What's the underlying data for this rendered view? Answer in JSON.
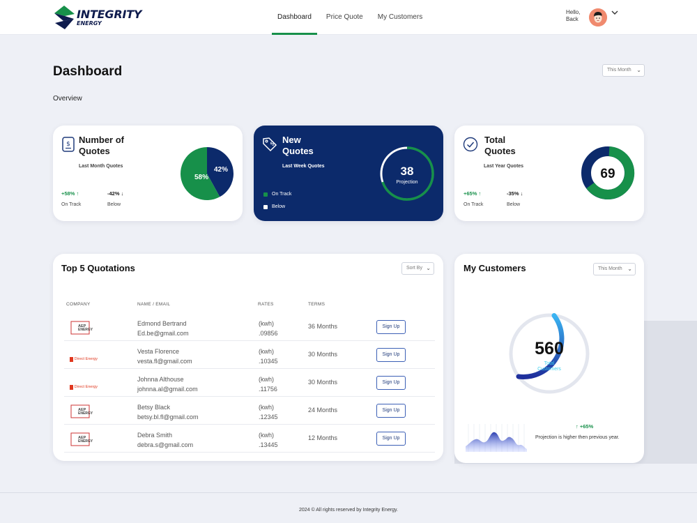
{
  "brand": {
    "name_line1": "INTEGRITY",
    "name_line2": "ENERGY",
    "colors": {
      "green": "#17904a",
      "navy": "#0c2a6b"
    }
  },
  "nav": {
    "items": [
      {
        "label": "Dashboard",
        "active": true
      },
      {
        "label": "Price Quote"
      },
      {
        "label": "My Customers"
      }
    ]
  },
  "user": {
    "greeting_line1": "Hello,",
    "greeting_line2": "Back",
    "avatar_icon": "avatar-icon",
    "menu_icon": "chevron-down-icon"
  },
  "page": {
    "title": "Dashboard",
    "subtitle": "Overview",
    "period_select": "This Month"
  },
  "cards": {
    "quotes": {
      "title_line1": "Number of",
      "title_line2": "Quotes",
      "subtitle": "Last Month Quotes",
      "icon": "invoice-dollar-icon",
      "stat1_value": "+58%",
      "stat1_arrow": "↑",
      "stat1_label": "On Track",
      "stat2_value": "-42%",
      "stat2_arrow": "↓",
      "stat2_label": "Below",
      "pie": {
        "green_label": "58%",
        "navy_label": "42%",
        "green_value": 58,
        "navy_value": 42
      }
    },
    "new_quotes": {
      "title_line1": "New",
      "title_line2": "Quotes",
      "subtitle": "Last Week Quotes",
      "icon": "price-tag-icon",
      "legend1": "On Track",
      "legend2": "Below",
      "value": "38",
      "value_label": "Projection"
    },
    "total_quotes": {
      "title_line1": "Total",
      "title_line2": "Quotes",
      "subtitle": "Last Year Quotes",
      "icon": "check-circle-icon",
      "stat1_value": "+65%",
      "stat1_arrow": "↑",
      "stat1_label": "On Track",
      "stat2_value": "-35%",
      "stat2_arrow": "↓",
      "stat2_label": "Below",
      "value": "69"
    }
  },
  "quotations": {
    "title": "Top 5 Quotations",
    "sort_label": "Sort By",
    "columns": {
      "company": "COMPANY",
      "name": "NAME / EMAIL",
      "rates": "RATES",
      "terms": "TERMS"
    },
    "rows": [
      {
        "company_logo": "aep-energy-logo",
        "name": "Edmond Bertrand",
        "email": "Ed.be@gmail.com",
        "unit": "(kwh)",
        "rate": ".09856",
        "term": "36 Months",
        "action": "Sign Up"
      },
      {
        "company_logo": "direct-energy-logo",
        "company_text": "Direct Energy",
        "name": "Vesta Florence",
        "email": "vesta.fl@gmail.com",
        "unit": "(kwh)",
        "rate": ".10345",
        "term": "30 Months",
        "action": "Sign Up"
      },
      {
        "company_logo": "direct-energy-logo",
        "company_text": "Direct Energy",
        "name": "Johnna Althouse",
        "email": "johnna.al@gmail.com",
        "unit": "(kwh)",
        "rate": ".11756",
        "term": "30 Months",
        "action": "Sign Up"
      },
      {
        "company_logo": "aep-energy-logo",
        "name": "Betsy Black",
        "email": "betsy.bl.fl@gmail.com",
        "unit": "(kwh)",
        "rate": ".12345",
        "term": "24 Months",
        "action": "Sign Up"
      },
      {
        "company_logo": "aep-energy-logo",
        "name": "Debra Smith",
        "email": "debra.s@gmail.com",
        "unit": "(kwh)",
        "rate": ".13445",
        "term": "12 Months",
        "action": "Sign Up"
      }
    ]
  },
  "customers": {
    "title": "My Customers",
    "period_select": "This Month",
    "value": "560",
    "label_line1": "Total",
    "label_line2": "Customers",
    "change": "+65%",
    "change_arrow": "↑",
    "note": "Projection is higher then previous year."
  },
  "footer": {
    "text": "2024 © All rights reserved by Integrity Energy."
  }
}
